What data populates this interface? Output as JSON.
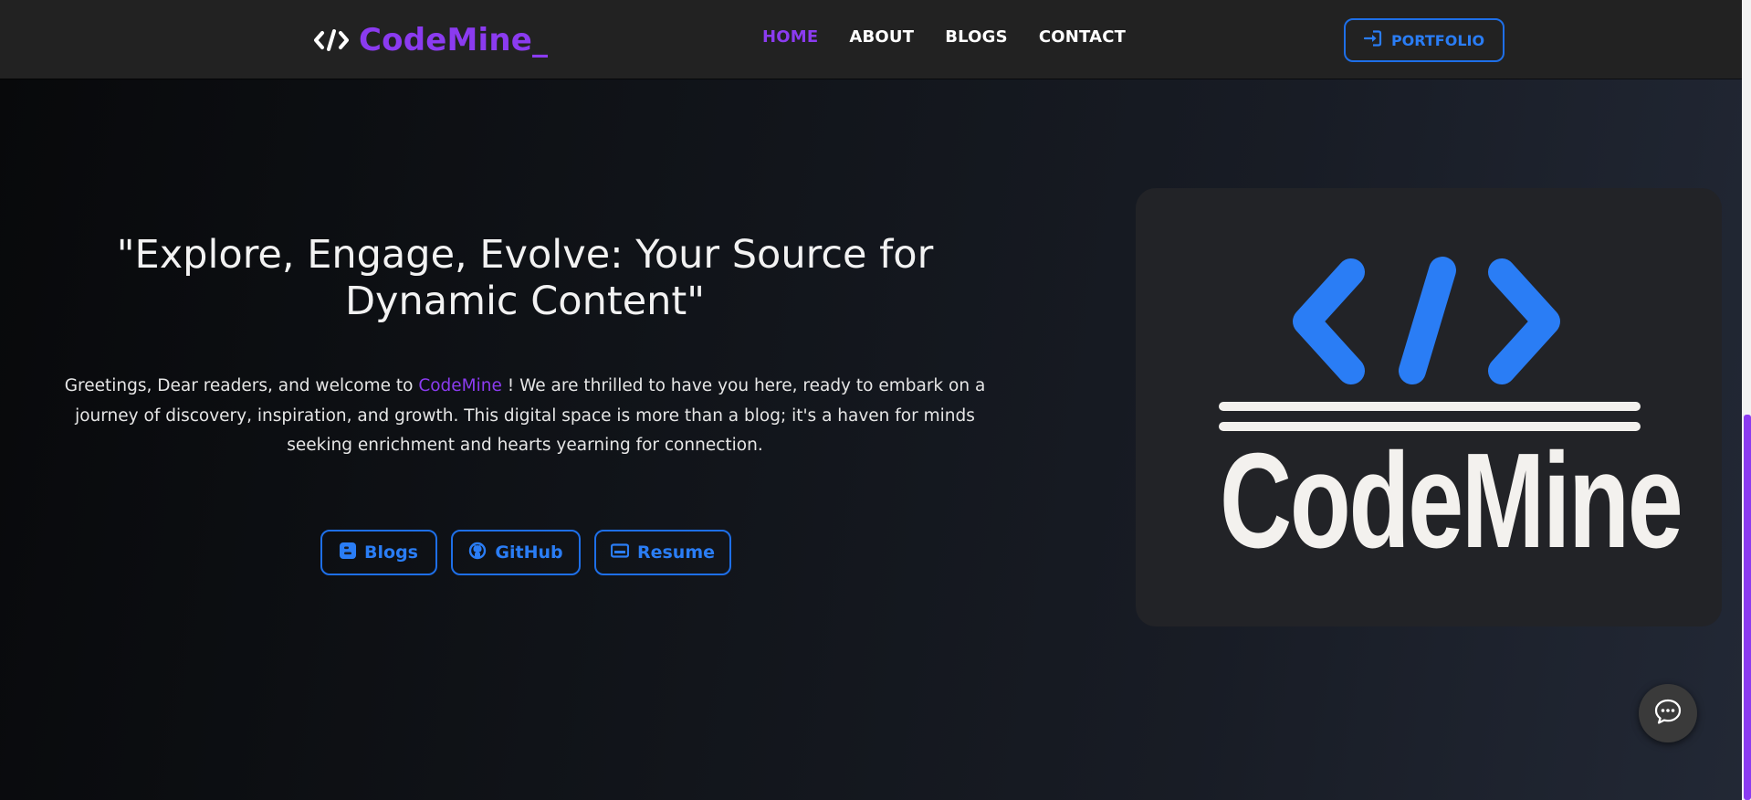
{
  "nav": {
    "brand": "CodeMine_",
    "brand_icon": "code-icon",
    "links": [
      {
        "label": "HOME",
        "active": true
      },
      {
        "label": "ABOUT",
        "active": false
      },
      {
        "label": "BLOGS",
        "active": false
      },
      {
        "label": "CONTACT",
        "active": false
      }
    ],
    "portfolio_label": "PORTFOLIO",
    "portfolio_icon": "sign-in-icon"
  },
  "hero": {
    "title_line1": "\"Explore, Engage, Evolve: Your Source for",
    "title_line2": "Dynamic Content\"",
    "text_before": "Greetings, Dear readers, and welcome to ",
    "text_highlight": "CodeMine",
    "text_after": " ! We are thrilled to have you here, ready to embark on a journey of discovery, inspiration, and growth. This digital space is more than a blog; it's a haven for minds seeking enrichment and hearts yearning for connection.",
    "buttons": [
      {
        "label": "Blogs",
        "icon": "blogger-icon"
      },
      {
        "label": "GitHub",
        "icon": "github-icon"
      },
      {
        "label": "Resume",
        "icon": "id-card-icon"
      }
    ]
  },
  "logo": {
    "word": "CodeMine",
    "icon": "code-brackets-icon"
  },
  "chat": {
    "icon": "chat-bubble-icon"
  },
  "colors": {
    "accent_purple": "#8b3bf0",
    "accent_blue": "#2a7df5",
    "navbar_bg": "#222222"
  }
}
